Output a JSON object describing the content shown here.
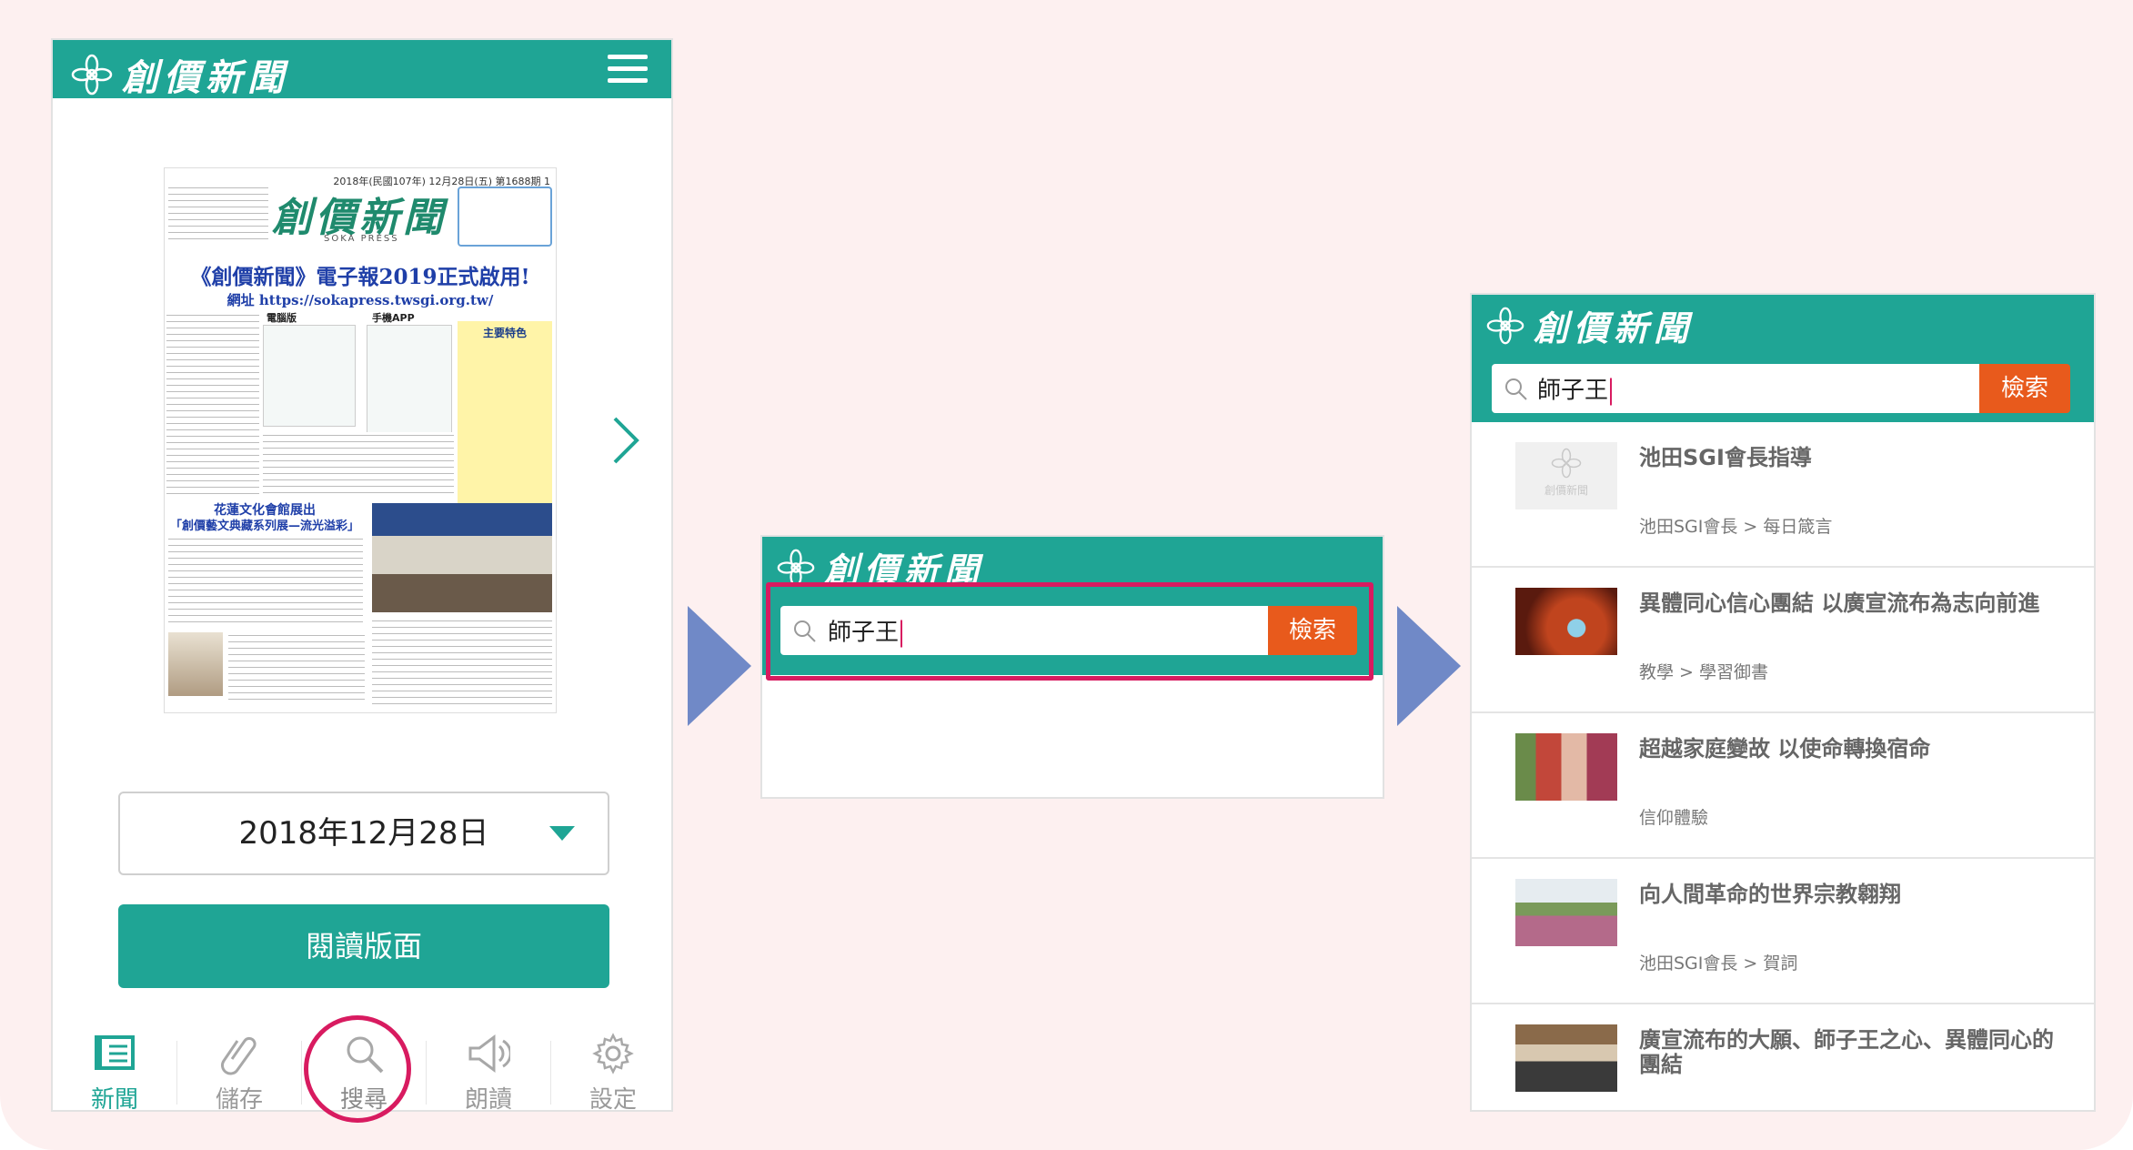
{
  "brand": {
    "name": "創價新聞",
    "teal": "#1fa595",
    "accent_orange": "#e85a1c",
    "highlight": "#d81b60",
    "arrow_color": "#7089c7"
  },
  "newspaper": {
    "date_line": "2018年(民國107年) 12月28日(五) 第1688期 1",
    "masthead": "創價新聞",
    "press": "SOKA  PRESS",
    "headline": "《創價新聞》電子報2019正式啟用!",
    "url_line": "網址  https://sokapress.twsgi.org.tw/",
    "label_pc": "電腦版",
    "label_app": "手機APP",
    "features_title": "主要特色",
    "sub_heading_1": "花蓮文化會館展出",
    "sub_heading_2": "「創價藝文典藏系列展—流光溢彩」"
  },
  "phone1": {
    "date_value": "2018年12月28日",
    "read_button": "閱讀版面",
    "tabs": [
      {
        "label": "新聞",
        "icon": "news-icon",
        "active": true
      },
      {
        "label": "儲存",
        "icon": "paperclip-icon",
        "active": false
      },
      {
        "label": "搜尋",
        "icon": "search-icon",
        "active": false
      },
      {
        "label": "朗讀",
        "icon": "speaker-icon",
        "active": false
      },
      {
        "label": "設定",
        "icon": "gear-icon",
        "active": false
      }
    ]
  },
  "search": {
    "query": "師子王",
    "button": "檢索"
  },
  "results": [
    {
      "title": "池田SGI會長指導",
      "category": "池田SGI會長 > 每日箴言",
      "thumb": "placeholder-logo",
      "thumb_text": "創價新聞"
    },
    {
      "title": "異體同心信心團結 以廣宣流布為志向前進",
      "category": "教學 > 學習御書",
      "thumb": "photo-red"
    },
    {
      "title": "超越家庭變故 以使命轉換宿命",
      "category": "信仰體驗",
      "thumb": "photo-family"
    },
    {
      "title": "向人間革命的世界宗教翱翔",
      "category": "池田SGI會長 > 賀詞",
      "thumb": "photo-crowd"
    },
    {
      "title": "廣宣流布的大願、師子王之心、異體同心的團結",
      "category": "",
      "thumb": "photo-hall"
    }
  ]
}
